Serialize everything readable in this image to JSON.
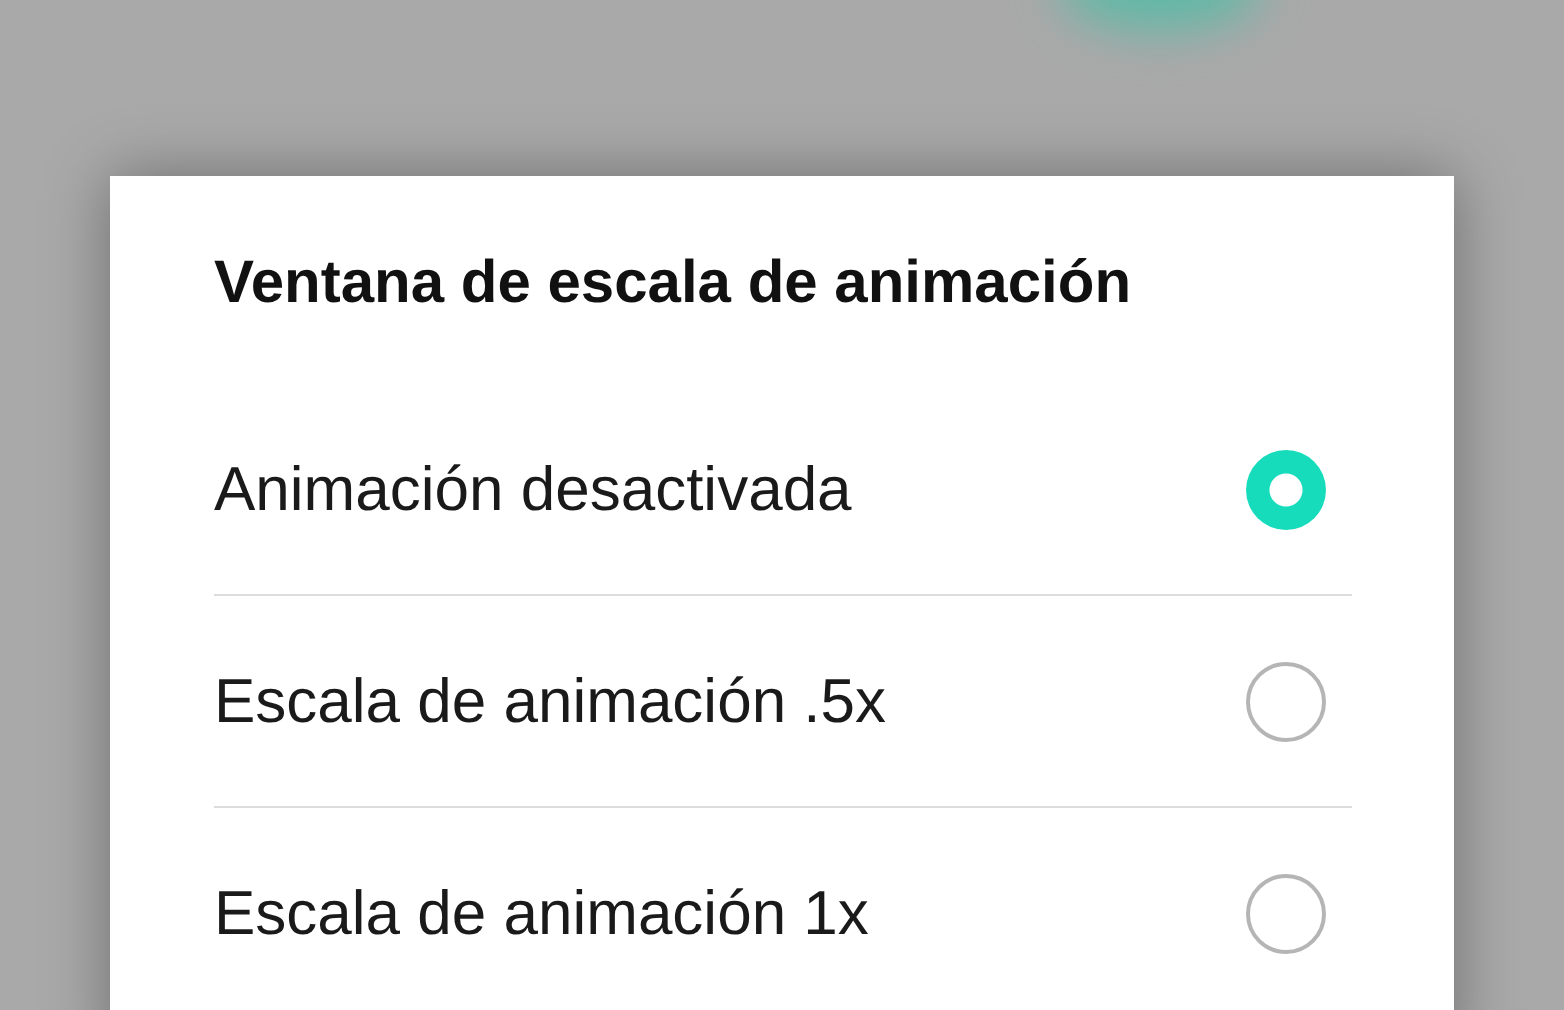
{
  "dialog": {
    "title": "Ventana de escala de animación",
    "options": [
      {
        "label": "Animación desactivada",
        "selected": true
      },
      {
        "label": "Escala de animación .5x",
        "selected": false
      },
      {
        "label": "Escala de animación 1x",
        "selected": false
      }
    ]
  }
}
